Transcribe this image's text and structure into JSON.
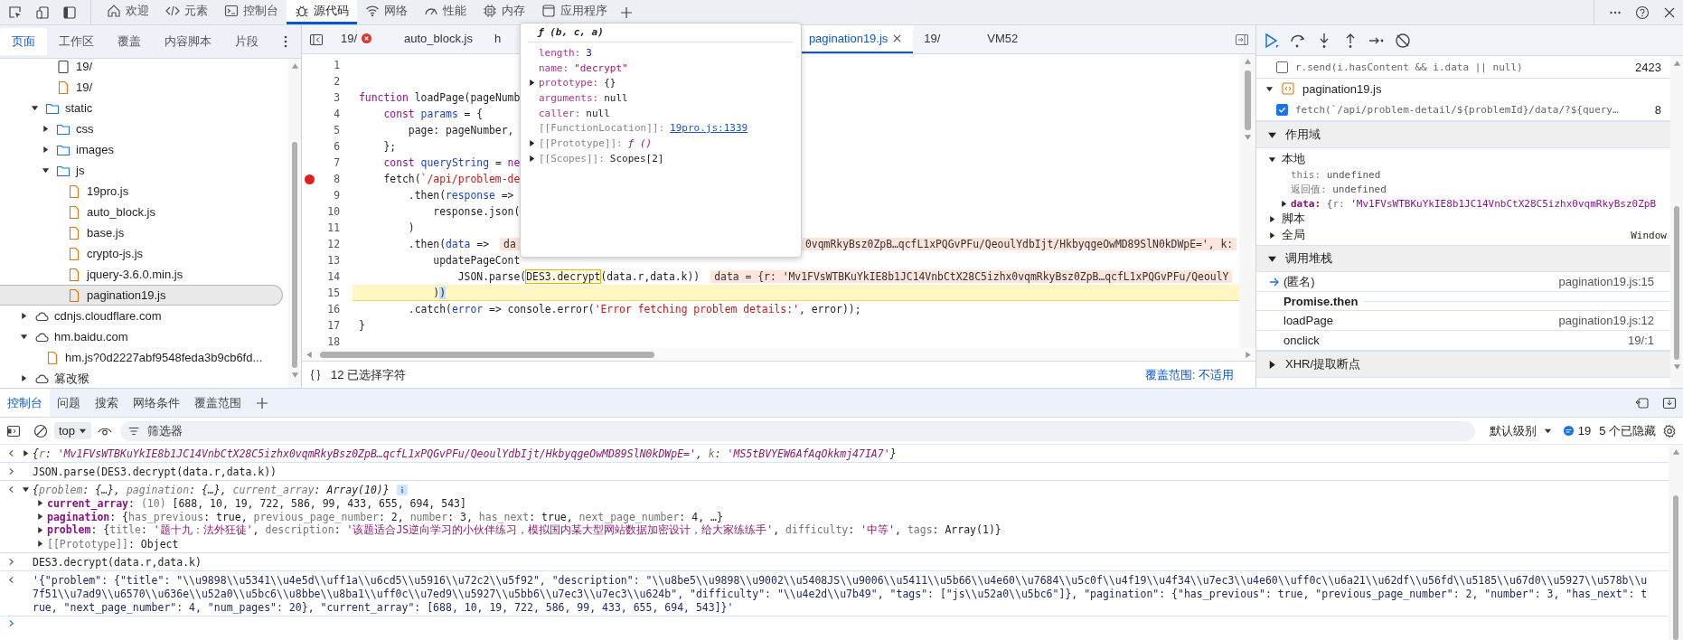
{
  "top_tabs": [
    {
      "kind": "welcome",
      "label": "欢迎",
      "selected": false
    },
    {
      "kind": "elements",
      "label": "元素",
      "selected": false
    },
    {
      "kind": "console",
      "label": "控制台",
      "selected": false
    },
    {
      "kind": "sources",
      "label": "源代码",
      "selected": true
    },
    {
      "kind": "network",
      "label": "网络",
      "selected": false
    },
    {
      "kind": "performance",
      "label": "性能",
      "selected": false
    },
    {
      "kind": "memory",
      "label": "内存",
      "selected": false
    },
    {
      "kind": "application",
      "label": "应用程序",
      "selected": false
    }
  ],
  "navigator": {
    "tabs": [
      {
        "label": "页面",
        "selected": true
      },
      {
        "label": "工作区",
        "selected": false
      },
      {
        "label": "覆盖",
        "selected": false
      },
      {
        "label": "内容脚本",
        "selected": false
      },
      {
        "label": "片段",
        "selected": false
      }
    ],
    "tree": [
      {
        "children": [
          {
            "children": [
              {
                "kind": "document",
                "label": "19/",
                "selected": false
              },
              {
                "kind": "file",
                "label": "19/",
                "selected": false
              }
            ]
          },
          {
            "kind": "folder",
            "label": "static",
            "expanded": true,
            "selected": false,
            "children": [
              {
                "kind": "folder",
                "label": "css",
                "expanded": false,
                "selected": false
              },
              {
                "kind": "folder",
                "label": "images",
                "expanded": false,
                "selected": false
              },
              {
                "kind": "folder",
                "label": "js",
                "expanded": true,
                "selected": false,
                "children": [
                  {
                    "kind": "file",
                    "label": "19pro.js",
                    "selected": false
                  },
                  {
                    "kind": "file",
                    "label": "auto_block.js",
                    "selected": false
                  },
                  {
                    "kind": "file",
                    "label": "base.js",
                    "selected": false
                  },
                  {
                    "kind": "file",
                    "label": "crypto-js.js",
                    "selected": false
                  },
                  {
                    "kind": "file",
                    "label": "jquery-3.6.0.min.js",
                    "selected": false
                  },
                  {
                    "kind": "file",
                    "label": "pagination19.js",
                    "selected": true
                  }
                ]
              }
            ]
          }
        ]
      },
      {
        "kind": "domain",
        "label": "cdnjs.cloudflare.com",
        "expanded": false,
        "selected": false
      },
      {
        "kind": "domain",
        "label": "hm.baidu.com",
        "expanded": true,
        "selected": false,
        "children": [
          {
            "kind": "file",
            "label": "hm.js?0d2227abf9548feda3b9cb6fd...",
            "selected": false
          }
        ]
      },
      {
        "kind": "domain",
        "label": "篡改猴",
        "expanded": false,
        "selected": false
      }
    ]
  },
  "editor": {
    "tabs": [
      {
        "label": "19/",
        "error": true,
        "clipped": false,
        "selected": false
      },
      {
        "label": "auto_block.js",
        "error": false,
        "clipped": false,
        "selected": false
      },
      {
        "label": "h",
        "error": false,
        "clipped": true,
        "selected": false
      },
      {
        "label": "pagination19.js",
        "error": false,
        "clipped": false,
        "selected": true
      },
      {
        "label": "19/",
        "error": false,
        "clipped": false,
        "selected": false
      },
      {
        "label": "VM52",
        "error": false,
        "clipped": false,
        "selected": false
      }
    ],
    "lines": [
      {
        "n": "1",
        "breakpoint": false,
        "current": false
      },
      {
        "n": "2",
        "breakpoint": false,
        "current": false
      },
      {
        "n": "3",
        "breakpoint": false,
        "current": false,
        "code": [
          {
            "kind": "kw",
            "t": "function"
          },
          {
            "kind": "p",
            "t": " loadPage(pageNumb"
          }
        ]
      },
      {
        "n": "4",
        "breakpoint": false,
        "current": false,
        "code": [
          {
            "kind": "kw",
            "t": "    const"
          },
          {
            "kind": "def",
            "t": " params"
          },
          {
            "kind": "p",
            "t": " = {"
          }
        ]
      },
      {
        "n": "5",
        "breakpoint": false,
        "current": false,
        "code": [
          {
            "kind": "p",
            "t": "        page: pageNumber,"
          }
        ]
      },
      {
        "n": "6",
        "breakpoint": false,
        "current": false,
        "code": [
          {
            "kind": "p",
            "t": "    };"
          }
        ]
      },
      {
        "n": "7",
        "breakpoint": false,
        "current": false,
        "code": [
          {
            "kind": "kw",
            "t": "    const"
          },
          {
            "kind": "def",
            "t": " queryString"
          },
          {
            "kind": "p",
            "t": " = "
          },
          {
            "kind": "kw",
            "t": "ne"
          }
        ]
      },
      {
        "n": "8",
        "breakpoint": true,
        "current": false,
        "code": [
          {
            "kind": "p",
            "t": "    fetch("
          },
          {
            "kind": "str",
            "t": "`/api/problem-de"
          }
        ]
      },
      {
        "n": "9",
        "breakpoint": false,
        "current": false,
        "code": [
          {
            "kind": "p",
            "t": "        .then("
          },
          {
            "kind": "def",
            "t": "response"
          },
          {
            "kind": "p",
            "t": " =>"
          }
        ]
      },
      {
        "n": "10",
        "breakpoint": false,
        "current": false,
        "code": [
          {
            "kind": "p",
            "t": "            response.json("
          }
        ]
      },
      {
        "n": "11",
        "breakpoint": false,
        "current": false,
        "code": [
          {
            "kind": "p",
            "t": "        )"
          }
        ]
      },
      {
        "n": "12",
        "breakpoint": false,
        "current": false,
        "code": [
          {
            "kind": "p",
            "t": "        .then("
          },
          {
            "kind": "def",
            "t": "data"
          },
          {
            "kind": "p",
            "t": " =>"
          }
        ],
        "value": "da",
        "tail": "0vqmRkyBsz0ZpB…qcfL1xPQGvPFu/QeoulYdbIjt/HkbyqgeOwMD89SlN0kDWpE=', k:"
      },
      {
        "n": "13",
        "breakpoint": false,
        "current": false,
        "code": [
          {
            "kind": "p",
            "t": "            updatePageCont"
          }
        ]
      },
      {
        "n": "14",
        "breakpoint": false,
        "current": false,
        "code": [
          {
            "kind": "p",
            "t": "                JSON.parse("
          },
          {
            "kind": "hl",
            "t": "DES3.decrypt"
          },
          {
            "kind": "p",
            "t": "(data.r,data.k))"
          }
        ],
        "value": "data = {r: 'Mv1FVsWTBKuYkIE8b1JC14VnbCtX28C5izhx0vqmRkyBsz0ZpB…qcfL1xPQGvPFu/QeoulY"
      },
      {
        "n": "15",
        "breakpoint": false,
        "current": true,
        "code": [
          {
            "kind": "p",
            "t": "            )"
          },
          {
            "kind": "sel",
            "t": ")"
          }
        ]
      },
      {
        "n": "16",
        "breakpoint": false,
        "current": false,
        "code": [
          {
            "kind": "p",
            "t": "        .catch("
          },
          {
            "kind": "def",
            "t": "error"
          },
          {
            "kind": "p",
            "t": " => console.error("
          },
          {
            "kind": "str",
            "t": "'Error fetching problem details:'"
          },
          {
            "kind": "p",
            "t": ", error));"
          }
        ]
      },
      {
        "n": "17",
        "breakpoint": false,
        "current": false,
        "code": [
          {
            "kind": "p",
            "t": "}"
          }
        ]
      },
      {
        "n": "18",
        "breakpoint": false,
        "current": false
      }
    ],
    "status": "12 已选择字符",
    "coverage": "覆盖范围: 不适用"
  },
  "tooltip": {
    "title": "ƒ (b, c, a)",
    "rows": [
      {
        "key": "length:",
        "value": "3",
        "kind": "num",
        "expandable": false,
        "internal": false
      },
      {
        "key": "name:",
        "value": "\"decrypt\"",
        "kind": "str",
        "expandable": false,
        "internal": false
      },
      {
        "key": "prototype:",
        "value": "{}",
        "kind": "p",
        "expandable": true,
        "internal": false
      },
      {
        "key": "arguments:",
        "value": "null",
        "kind": "p",
        "expandable": false,
        "internal": false
      },
      {
        "key": "caller:",
        "value": "null",
        "kind": "p",
        "expandable": false,
        "internal": false
      },
      {
        "key": "[[FunctionLocation]]:",
        "value": "19pro.js:1339",
        "kind": "link",
        "expandable": false,
        "internal": true
      },
      {
        "key": "[[Prototype]]:",
        "value": "ƒ ()",
        "kind": "fn",
        "expandable": true,
        "internal": true
      },
      {
        "key": "[[Scopes]]:",
        "value": "Scopes[2]",
        "kind": "p",
        "expandable": true,
        "internal": true
      }
    ]
  },
  "debugger": {
    "breakpoints": [
      {
        "kind": "row",
        "code": "r.send(i.hasContent && i.data || null)",
        "line": "2423",
        "checked": false
      },
      {
        "kind": "file",
        "label": "pagination19.js",
        "expanded": true
      },
      {
        "kind": "row",
        "code": "fetch(`/api/problem-detail/${problemId}/data/?${query…",
        "line": "8",
        "checked": true
      }
    ],
    "sections": [
      {
        "kind": "scope",
        "title": "作用域",
        "expanded": true,
        "groups": [
          {
            "label": "本地",
            "expanded": true,
            "vars": [
              {
                "key": "this:",
                "expandable": false,
                "segs": [
                  {
                    "kind": "p",
                    "t": "undefined"
                  }
                ]
              },
              {
                "key": "返回值:",
                "expandable": false,
                "segs": [
                  {
                    "kind": "p",
                    "t": "undefined"
                  }
                ]
              },
              {
                "key": "data:",
                "expandable": true,
                "segs": [
                  {
                    "kind": "p",
                    "t": "{"
                  },
                  {
                    "kind": "pk",
                    "t": "r:"
                  },
                  {
                    "kind": "str",
                    "t": " 'Mv1FVsWTBKuYkIE8b1JC14VnbCtX28C5izhx0vqmRkyBsz0ZpB"
                  }
                ]
              }
            ]
          },
          {
            "label": "脚本",
            "expanded": false
          },
          {
            "label": "全局",
            "expanded": false,
            "value": "Window"
          }
        ]
      },
      {
        "kind": "callstack",
        "title": "调用堆栈",
        "expanded": true,
        "frames": [
          {
            "kind": "frame",
            "name": "(匿名)",
            "location": "pagination19.js:15",
            "current": true
          },
          {
            "kind": "async",
            "name": "Promise.then"
          },
          {
            "kind": "frame",
            "name": "loadPage",
            "location": "pagination19.js:12",
            "current": false
          },
          {
            "kind": "frame",
            "name": "onclick",
            "location": "19/:1",
            "current": false
          }
        ]
      },
      {
        "title": "XHR/提取断点",
        "expanded": false
      }
    ]
  },
  "drawer": {
    "tabs": [
      {
        "label": "控制台",
        "selected": true
      },
      {
        "label": "问题",
        "selected": false
      },
      {
        "label": "搜索",
        "selected": false
      },
      {
        "label": "网络条件",
        "selected": false
      },
      {
        "label": "覆盖范围",
        "selected": false
      }
    ],
    "context": "top",
    "placeholder": "筛选器",
    "level": "默认级别",
    "message_count": "19",
    "hidden": "5 个已隐藏",
    "messages": [
      {
        "kind": "output",
        "expandable": true,
        "expanded": false,
        "italic": true,
        "lines": [
          [
            {
              "kind": "p",
              "t": "{"
            },
            {
              "kind": "pk",
              "t": "r"
            },
            {
              "kind": "p",
              "t": ": "
            },
            {
              "kind": "str",
              "t": "'Mv1FVsWTBKuYkIE8b1JC14VnbCtX28C5izhx0vqmRkyBsz0ZpB…qcfL1xPQGvPFu/QeoulYdbIjt/HkbyqgeOwMD89SlN0kDWpE='"
            },
            {
              "kind": "p",
              "t": ", "
            },
            {
              "kind": "pk",
              "t": "k"
            },
            {
              "kind": "p",
              "t": ": "
            },
            {
              "kind": "str",
              "t": "'MS5tBVYEW6AfAqOkkmj47IA7'"
            },
            {
              "kind": "p",
              "t": "}"
            }
          ]
        ]
      },
      {
        "kind": "input",
        "lines": [
          [
            {
              "kind": "p",
              "t": "JSON.parse(DES3.decrypt(data.r,data.k))"
            }
          ]
        ]
      },
      {
        "kind": "output",
        "expandable": true,
        "expanded": true,
        "italic": true,
        "info": true,
        "lines": [
          [
            {
              "kind": "p",
              "t": "{"
            },
            {
              "kind": "pk",
              "t": "problem"
            },
            {
              "kind": "p",
              "t": ": {…}, "
            },
            {
              "kind": "pk",
              "t": "pagination"
            },
            {
              "kind": "p",
              "t": ": {…}, "
            },
            {
              "kind": "pk",
              "t": "current_array"
            },
            {
              "kind": "p",
              "t": ": Array(10)}"
            }
          ]
        ],
        "children": [
          {
            "expandable": true,
            "segs": [
              {
                "kind": "key",
                "t": "current_array"
              },
              {
                "kind": "p",
                "t": ": "
              },
              {
                "kind": "pk",
                "t": "(10) "
              },
              {
                "kind": "p",
                "t": "[688, 10, 19, 722, 586, 99, 433, 655, 694, 543]"
              }
            ]
          },
          {
            "expandable": true,
            "segs": [
              {
                "kind": "key",
                "t": "pagination"
              },
              {
                "kind": "p",
                "t": ": {"
              },
              {
                "kind": "pk",
                "t": "has_previous"
              },
              {
                "kind": "p",
                "t": ": true, "
              },
              {
                "kind": "pk",
                "t": "previous_page_number"
              },
              {
                "kind": "p",
                "t": ": 2, "
              },
              {
                "kind": "pk",
                "t": "number"
              },
              {
                "kind": "p",
                "t": ": 3, "
              },
              {
                "kind": "pk",
                "t": "has_next"
              },
              {
                "kind": "p",
                "t": ": true, "
              },
              {
                "kind": "pk",
                "t": "next_page_number"
              },
              {
                "kind": "p",
                "t": ": 4, …}"
              }
            ]
          },
          {
            "expandable": true,
            "segs": [
              {
                "kind": "key",
                "t": "problem"
              },
              {
                "kind": "p",
                "t": ": {"
              },
              {
                "kind": "pk",
                "t": "title"
              },
              {
                "kind": "p",
                "t": ": "
              },
              {
                "kind": "str",
                "t": "'题十九：法外狂徒'"
              },
              {
                "kind": "p",
                "t": ", "
              },
              {
                "kind": "pk",
                "t": "description"
              },
              {
                "kind": "p",
                "t": ": "
              },
              {
                "kind": "str",
                "t": "'该题适合JS逆向学习的小伙伴练习，模拟国内某大型网站数据加密设计，给大家练练手'"
              },
              {
                "kind": "p",
                "t": ", "
              },
              {
                "kind": "pk",
                "t": "difficulty"
              },
              {
                "kind": "p",
                "t": ": "
              },
              {
                "kind": "str",
                "t": "'中等'"
              },
              {
                "kind": "p",
                "t": ", "
              },
              {
                "kind": "pk",
                "t": "tags"
              },
              {
                "kind": "p",
                "t": ": Array(1)}"
              }
            ]
          },
          {
            "expandable": true,
            "segs": [
              {
                "kind": "pk",
                "t": "[[Prototype]]"
              },
              {
                "kind": "p",
                "t": ": Object"
              }
            ]
          }
        ]
      },
      {
        "kind": "input",
        "lines": [
          [
            {
              "kind": "p",
              "t": "DES3.decrypt(data.r,data.k)"
            }
          ]
        ]
      },
      {
        "kind": "output",
        "expandable": false,
        "italic": false,
        "lines": [
          [
            {
              "kind": "s2",
              "t": "'{\"problem\": {\"title\": \"\\\\u9898\\\\u5341\\\\u4e5d\\\\uff1a\\\\u6cd5\\\\u5916\\\\u72c2\\\\u5f92\", \"description\": \"\\\\u8be5\\\\u9898\\\\u9002\\\\u5408JS\\\\u9006\\\\u5411\\\\u5b66\\\\u4e60\\\\u7684\\\\u5c0f\\\\u4f19\\\\u4f34\\\\u7ec3\\\\u4e60\\\\uff0c\\\\u6a21\\\\u62df\\\\u56fd\\\\u5185\\\\u67d0\\\\u5927\\\\u578b\\\\u"
            }
          ],
          [
            {
              "kind": "s2",
              "t": "7f51\\\\u7ad9\\\\u6570\\\\u636e\\\\u52a0\\\\u5bc6\\\\u8bbe\\\\u8ba1\\\\uff0c\\\\u7ed9\\\\u5927\\\\u5bb6\\\\u7ec3\\\\u7ec3\\\\u624b\", \"difficulty\": \"\\\\u4e2d\\\\u7b49\", \"tags\": [\"js\\\\u52a0\\\\u5bc6\"]}, \"pagination\": {\"has_previous\": true, \"previous_page_number\": 2, \"number\": 3, \"has_next\": t"
            }
          ],
          [
            {
              "kind": "s2",
              "t": "rue, \"next_page_number\": 4, \"num_pages\": 20}, \"current_array\": [688, 10, 19, 722, 586, 99, 433, 655, 694, 543]}'"
            }
          ]
        ]
      }
    ]
  }
}
